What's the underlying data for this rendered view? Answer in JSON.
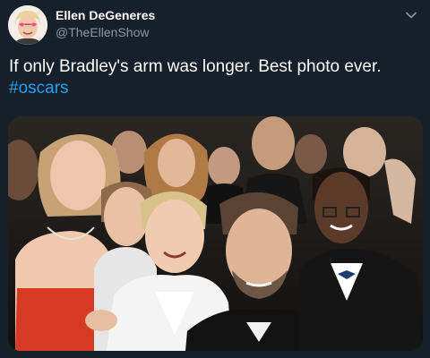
{
  "author": {
    "name": "Ellen DeGeneres",
    "handle": "@TheEllenShow"
  },
  "tweet": {
    "text": "If only Bradley's arm was longer. Best photo ever.",
    "hashtag": "#oscars"
  },
  "icons": {
    "menu": "chevron-down-icon",
    "avatar": "avatar-photo"
  },
  "colors": {
    "background": "#15202b",
    "text": "#ffffff",
    "secondary_text": "#8899a6",
    "hashtag": "#1da1f2"
  }
}
